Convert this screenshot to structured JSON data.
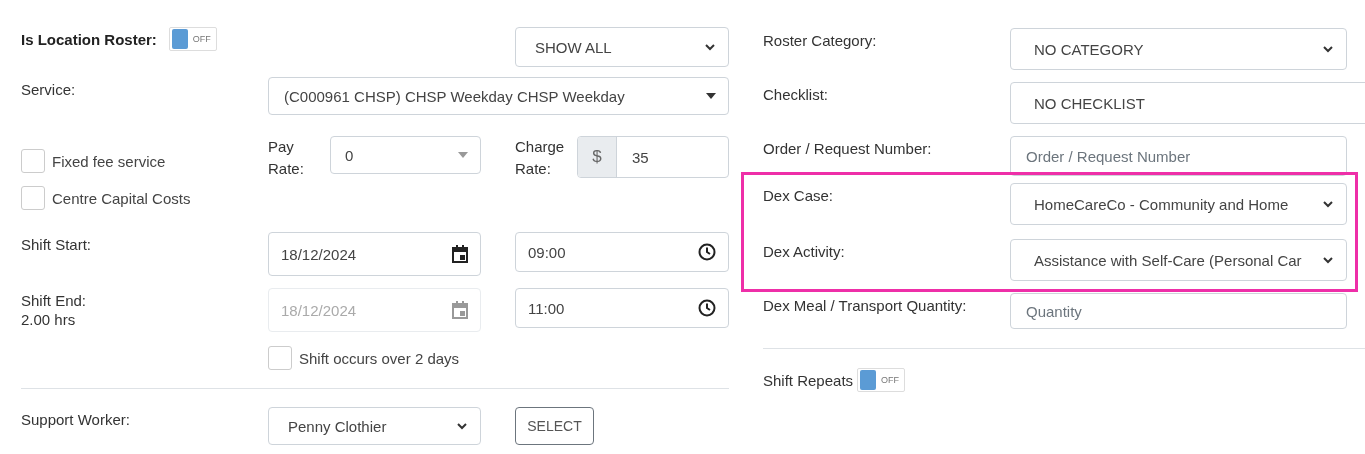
{
  "location_roster": {
    "label": "Is Location Roster:",
    "toggle": {
      "text": "OFF",
      "on": false
    }
  },
  "filter": {
    "value": "SHOW ALL"
  },
  "service": {
    "label": "Service:",
    "value": "(C000961 CHSP) CHSP Weekday CHSP Weekday"
  },
  "options": [
    {
      "label": "Fixed fee service",
      "checked": false
    },
    {
      "label": "Centre Capital Costs",
      "checked": false
    }
  ],
  "pay_rate": {
    "label": "Pay Rate:",
    "value": "0"
  },
  "charge_rate": {
    "label": "Charge Rate:",
    "prefix": "$",
    "value": "35"
  },
  "shift_start": {
    "label": "Shift Start:",
    "date": "18/12/2024",
    "date_disabled": false,
    "time": "09:00"
  },
  "shift_end": {
    "label": "Shift End:",
    "duration": "2.00 hrs",
    "date": "18/12/2024",
    "date_disabled": true,
    "time": "11:00"
  },
  "overnight": {
    "label": "Shift occurs over 2 days",
    "checked": false
  },
  "support_worker": {
    "label": "Support Worker:",
    "value": "Penny Clothier",
    "button": "SELECT"
  },
  "right_fields": [
    {
      "kind": "select",
      "label": "Roster Category:",
      "value": "NO CATEGORY",
      "highlighted": false
    },
    {
      "kind": "plain",
      "label": "Checklist:",
      "value": "NO CHECKLIST",
      "highlighted": false
    },
    {
      "kind": "input",
      "label": "Order / Request Number:",
      "placeholder": "Order / Request Number",
      "highlighted": false
    },
    {
      "kind": "select",
      "label": "Dex Case:",
      "value": "HomeCareCo - Community and Home",
      "highlighted": true
    },
    {
      "kind": "select",
      "label": "Dex Activity:",
      "value": "Assistance with Self-Care (Personal Car",
      "highlighted": true
    },
    {
      "kind": "input",
      "label": "Dex Meal / Transport Quantity:",
      "placeholder": "Quantity",
      "highlighted": false
    }
  ],
  "shift_repeats": {
    "label": "Shift Repeats",
    "toggle": {
      "text": "OFF",
      "on": false
    }
  }
}
